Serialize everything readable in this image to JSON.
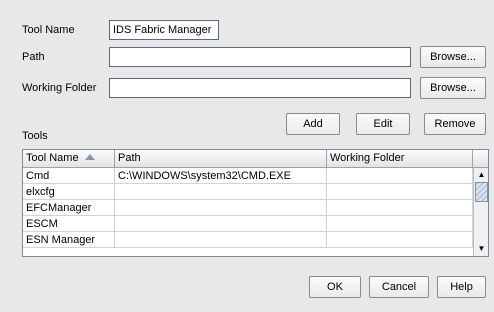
{
  "form": {
    "tool_name_label": "Tool Name",
    "tool_name_value": "IDS Fabric Manager",
    "path_label": "Path",
    "path_value": "",
    "working_folder_label": "Working Folder",
    "working_folder_value": "",
    "browse_path_label": "Browse...",
    "browse_folder_label": "Browse..."
  },
  "tools": {
    "label": "Tools",
    "add_label": "Add",
    "edit_label": "Edit",
    "remove_label": "Remove"
  },
  "table": {
    "columns": [
      "Tool Name",
      "Path",
      "Working Folder"
    ],
    "sort_icon": "sort-ascending-icon",
    "rows": [
      {
        "name": "Cmd",
        "path": "C:\\WINDOWS\\system32\\CMD.EXE",
        "folder": ""
      },
      {
        "name": "elxcfg",
        "path": "",
        "folder": ""
      },
      {
        "name": "EFCManager",
        "path": "",
        "folder": ""
      },
      {
        "name": "ESCM",
        "path": "",
        "folder": ""
      },
      {
        "name": "ESN Manager",
        "path": "",
        "folder": ""
      }
    ]
  },
  "footer": {
    "ok_label": "OK",
    "cancel_label": "Cancel",
    "help_label": "Help"
  }
}
